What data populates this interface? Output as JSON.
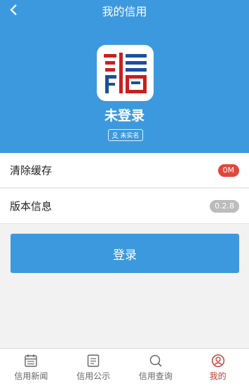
{
  "header": {
    "title": "我的信用",
    "back_icon": "chevron-left-icon",
    "user_status": "未登录",
    "realname_badge": "未实名"
  },
  "menu": {
    "items": [
      {
        "label": "清除缓存",
        "badge": "0M",
        "badge_color": "#e2463a"
      },
      {
        "label": "版本信息",
        "badge": "0.2.8",
        "badge_color": "#bcbcbc"
      }
    ]
  },
  "login_button": "登录",
  "tabs": [
    {
      "label": "信用新闻",
      "icon": "calendar-icon"
    },
    {
      "label": "信用公示",
      "icon": "notice-board-icon"
    },
    {
      "label": "信用查询",
      "icon": "search-icon"
    },
    {
      "label": "我的",
      "icon": "user-circle-icon"
    }
  ],
  "colors": {
    "primary": "#3d99dd",
    "logo_red": "#c8201f",
    "logo_blue": "#1c4f9c"
  }
}
